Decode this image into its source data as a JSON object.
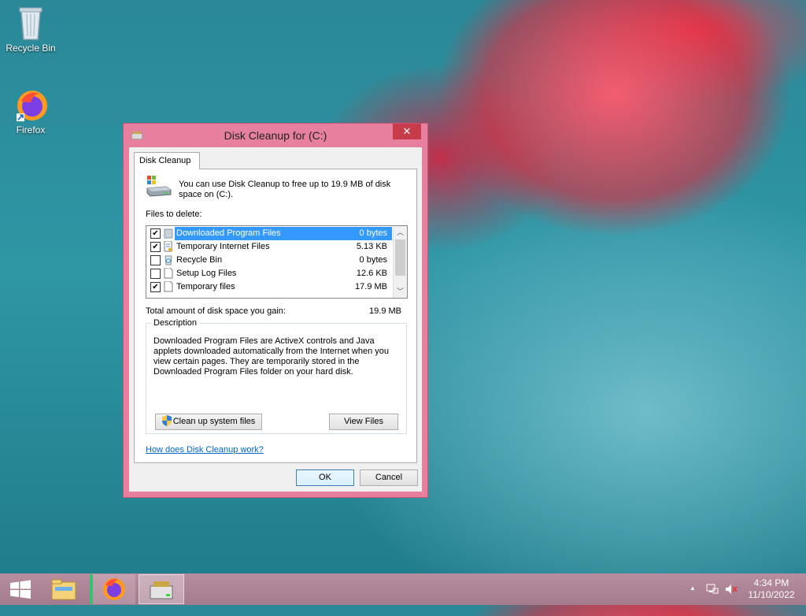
{
  "desktop": {
    "icons": [
      {
        "label": "Recycle Bin"
      },
      {
        "label": "Firefox"
      }
    ]
  },
  "dialog": {
    "title": "Disk Cleanup for  (C:)",
    "close_glyph": "✕",
    "tab_label": "Disk Cleanup",
    "intro_text": "You can use Disk Cleanup to free up to 19.9 MB of disk space on  (C:).",
    "files_to_delete_label": "Files to delete:",
    "files": [
      {
        "name": "Downloaded Program Files",
        "size": "0 bytes",
        "checked": true,
        "selected": true,
        "icon": "folder-icon"
      },
      {
        "name": "Temporary Internet Files",
        "size": "5.13 KB",
        "checked": true,
        "selected": false,
        "icon": "document-lock-icon"
      },
      {
        "name": "Recycle Bin",
        "size": "0 bytes",
        "checked": false,
        "selected": false,
        "icon": "recycle-bin-icon"
      },
      {
        "name": "Setup Log Files",
        "size": "12.6 KB",
        "checked": false,
        "selected": false,
        "icon": "file-icon"
      },
      {
        "name": "Temporary files",
        "size": "17.9 MB",
        "checked": true,
        "selected": false,
        "icon": "file-icon"
      }
    ],
    "total_label": "Total amount of disk space you gain:",
    "total_value": "19.9 MB",
    "description_label": "Description",
    "description_text": "Downloaded Program Files are ActiveX controls and Java applets downloaded automatically from the Internet when you view certain pages. They are temporarily stored in the Downloaded Program Files folder on your hard disk.",
    "cleanup_system_button": "Clean up system files",
    "view_files_button": "View Files",
    "help_link": "How does Disk Cleanup work?",
    "ok_button": "OK",
    "cancel_button": "Cancel"
  },
  "taskbar": {
    "time": "4:34 PM",
    "date": "11/10/2022",
    "tray_arrow": "▲"
  },
  "colors": {
    "dialog_frame": "#e7809f",
    "selection": "#3399ff",
    "link": "#0066cc",
    "taskbar": "#b78da0"
  }
}
